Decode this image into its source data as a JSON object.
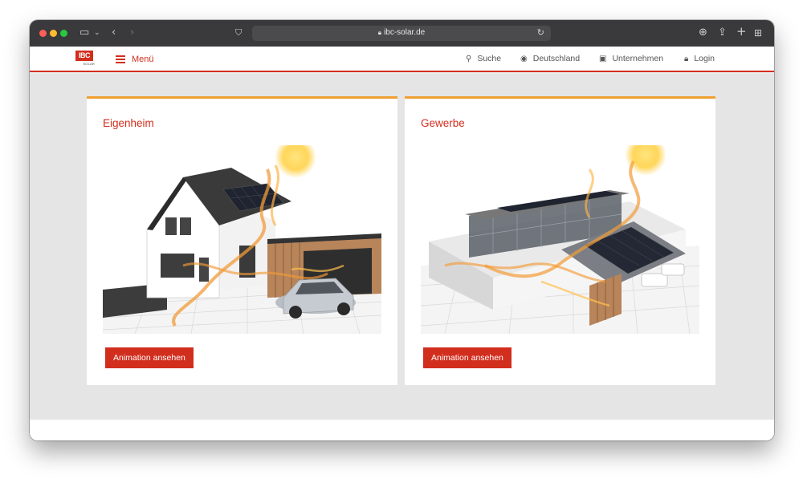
{
  "browser": {
    "url": "ibc-solar.de",
    "icons": [
      "sidebar-icon",
      "chevron-down-icon",
      "back-icon",
      "forward-icon",
      "shield-icon",
      "lock-icon",
      "reload-icon",
      "download-icon",
      "share-icon",
      "new-tab-icon",
      "tab-overview-icon"
    ]
  },
  "header": {
    "logo_text": "IBC",
    "logo_sub": "SOLAR",
    "menu_label": "Menü",
    "nav": [
      {
        "label": "Suche",
        "icon": "search-icon"
      },
      {
        "label": "Deutschland",
        "icon": "globe-icon"
      },
      {
        "label": "Unternehmen",
        "icon": "briefcase-icon"
      },
      {
        "label": "Login",
        "icon": "lock-icon"
      }
    ]
  },
  "cards": [
    {
      "title": "Eigenheim",
      "button": "Animation ansehen",
      "image": "house-solar-illustration"
    },
    {
      "title": "Gewerbe",
      "button": "Animation ansehen",
      "image": "commercial-building-solar-illustration"
    }
  ],
  "colors": {
    "brand_red": "#d22e1e",
    "accent_orange": "#f0a030",
    "page_bg": "#e5e5e5"
  }
}
